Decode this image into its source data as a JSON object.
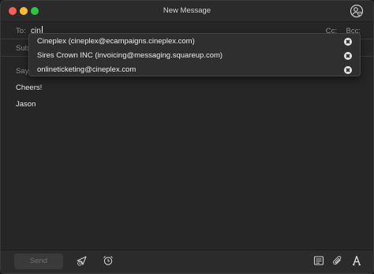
{
  "window": {
    "title": "New Message"
  },
  "fields": {
    "to_label": "To:",
    "to_value": "cin",
    "cc_label": "Cc:",
    "bcc_label": "Bcc:",
    "subject_label": "Subj"
  },
  "body": {
    "line1": "Say",
    "line2": "Cheers!",
    "line3": "Jason"
  },
  "autocomplete": [
    {
      "label": "Cineplex (cineplex@ecampaigns.cineplex.com)"
    },
    {
      "label": "Sires Crown INC (invoicing@messaging.squareup.com)"
    },
    {
      "label": "onlineticketing@cineplex.com"
    }
  ],
  "footer": {
    "send_label": "Send",
    "icons": [
      "send-later-icon",
      "alarm-clock-icon",
      "template-icon",
      "attachment-icon",
      "font-icon"
    ]
  }
}
